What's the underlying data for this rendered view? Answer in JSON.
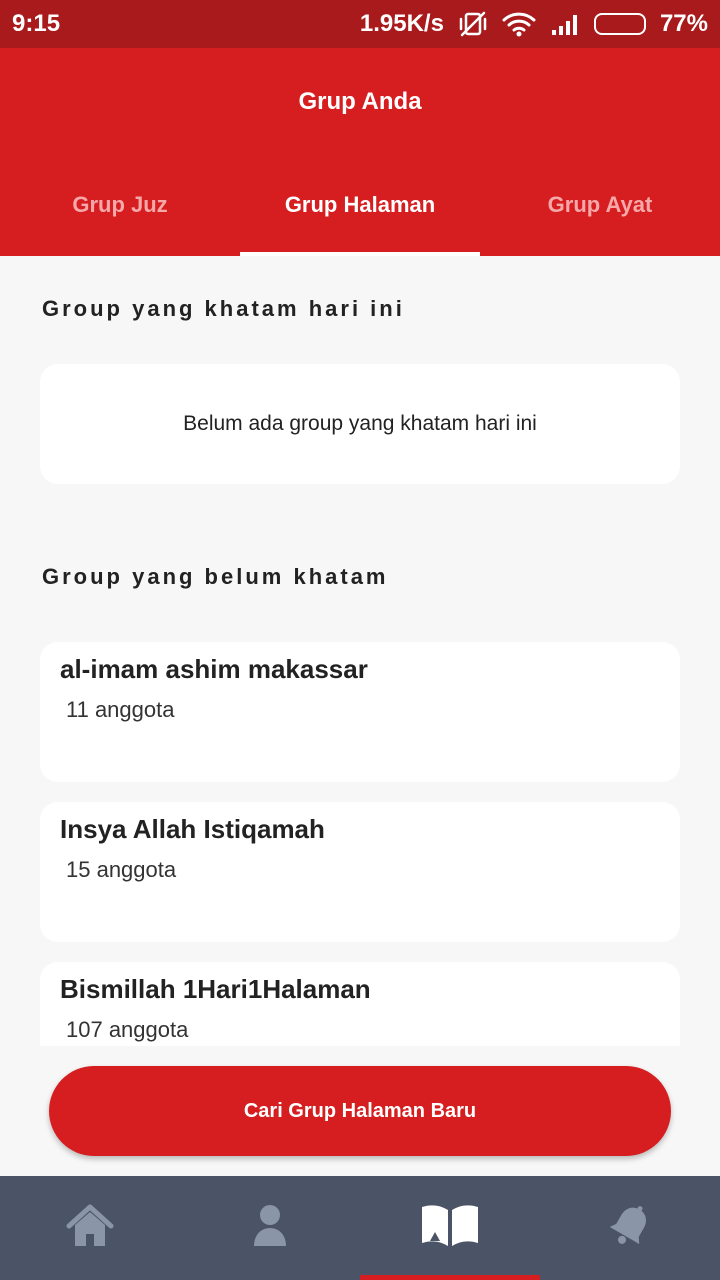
{
  "status_bar": {
    "time": "9:15",
    "speed": "1.95K/s",
    "battery": "77%",
    "battery_level": 0.77,
    "icons": [
      "mute-vibrate-icon",
      "wifi-icon",
      "signal-icon",
      "battery-icon"
    ]
  },
  "header": {
    "title": "Grup Anda",
    "tabs": [
      {
        "label": "Grup Juz",
        "active": false
      },
      {
        "label": "Grup Halaman",
        "active": true
      },
      {
        "label": "Grup Ayat",
        "active": false
      }
    ]
  },
  "khatam_section": {
    "title": "Group yang khatam hari ini",
    "empty_message": "Belum ada group yang khatam hari ini"
  },
  "belum_section": {
    "title": "Group yang belum khatam",
    "groups": [
      {
        "name": "al-imam ashim makassar",
        "members": "11 anggota"
      },
      {
        "name": "Insya Allah Istiqamah",
        "members": "15 anggota"
      },
      {
        "name": "Bismillah 1Hari1Halaman",
        "members": "107 anggota"
      }
    ]
  },
  "cta": {
    "label": "Cari Grup Halaman Baru"
  },
  "bottom_nav": {
    "items": [
      {
        "icon": "home-icon",
        "active": false
      },
      {
        "icon": "profile-icon",
        "active": false
      },
      {
        "icon": "book-icon",
        "active": true
      },
      {
        "icon": "bell-icon",
        "active": false
      }
    ]
  },
  "colors": {
    "primary": "#d61d1f",
    "status_bar": "#a81a1c",
    "nav_background": "#4a5466",
    "nav_icon": "#8b95a8",
    "background": "#f7f7f7"
  }
}
